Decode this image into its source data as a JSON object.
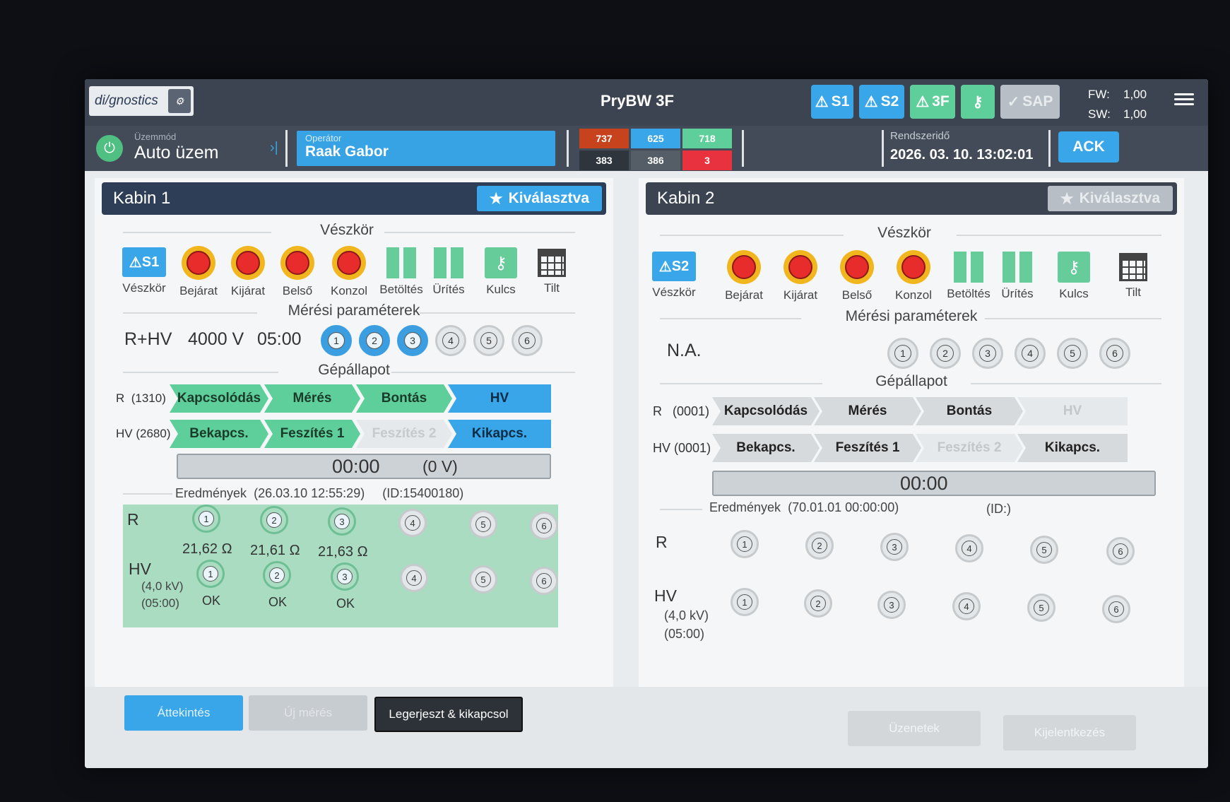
{
  "topbar": {
    "logo_text": "di/gnostics",
    "title": "PryBW 3F",
    "alarms": [
      {
        "label": "S1",
        "color": "#38a6e8"
      },
      {
        "label": "S2",
        "color": "#38a6e8"
      },
      {
        "label": "3F",
        "color": "#5ecf9a"
      }
    ],
    "sap_label": "SAP",
    "fw_label": "FW:",
    "fw_value": "1,00",
    "sw_label": "SW:",
    "sw_value": "1,00"
  },
  "status": {
    "mode_caption": "Üzemmód",
    "mode_value": "Auto üzem",
    "operator_caption": "Operátor",
    "operator_value": "Raak Gabor",
    "counters": [
      {
        "value": "737",
        "color": "#c6431e"
      },
      {
        "value": "625",
        "color": "#38a6e8"
      },
      {
        "value": "718",
        "color": "#5ecf9a"
      },
      {
        "value": "383",
        "color": "#2f353c"
      },
      {
        "value": "386",
        "color": "#555d66"
      },
      {
        "value": "3",
        "color": "#e8333f"
      }
    ],
    "system_time_caption": "Rendszeridő",
    "system_time_value": "2026. 03. 10. 13:02:01",
    "ack_label": "ACK"
  },
  "cabin1": {
    "title": "Kabin 1",
    "selected_label": "Kiválasztva",
    "estop_title": "Vészkör",
    "vb_label": "S1",
    "icons": [
      "Vészkör",
      "Bejárat",
      "Kijárat",
      "Belső",
      "Konzol",
      "Betöltés",
      "Ürítés",
      "Kulcs",
      "Tilt"
    ],
    "params_title": "Mérési paraméterek",
    "params": {
      "mode": "R+HV",
      "voltage": "4000 V",
      "time": "05:00"
    },
    "channels": [
      "1",
      "2",
      "3",
      "4",
      "5",
      "6"
    ],
    "state_title": "Gépállapot",
    "r_label": "R",
    "r_code": "(1310)",
    "hv_label": "HV",
    "hv_code": "(2680)",
    "r_steps": [
      "Kapcsolódás",
      "Mérés",
      "Bontás",
      "HV"
    ],
    "hv_steps": [
      "Bekapcs.",
      "Feszítés 1",
      "Feszítés 2",
      "Kikapcs."
    ],
    "progress_time": "00:00",
    "progress_voltage": "(0 V)",
    "results_title": "Eredmények",
    "results_date": "(26.03.10 12:55:29)",
    "results_id": "(ID:15400180)",
    "res_r_label": "R",
    "res_r_values": [
      "21,62 Ω",
      "21,61 Ω",
      "21,63 Ω"
    ],
    "res_hv_label": "HV",
    "res_hv_kv": "(4,0 kV)",
    "res_hv_time": "(05:00)",
    "res_hv_values": [
      "OK",
      "OK",
      "OK"
    ]
  },
  "cabin2": {
    "title": "Kabin 2",
    "selected_label": "Kiválasztva",
    "estop_title": "Vészkör",
    "vb_label": "S2",
    "icons": [
      "Vészkör",
      "Bejárat",
      "Kijárat",
      "Belső",
      "Konzol",
      "Betöltés",
      "Ürítés",
      "Kulcs",
      "Tilt"
    ],
    "params_title": "Mérési paraméterek",
    "params_na": "N.A.",
    "channels": [
      "1",
      "2",
      "3",
      "4",
      "5",
      "6"
    ],
    "state_title": "Gépállapot",
    "r_label": "R",
    "r_code": "(0001)",
    "hv_label": "HV",
    "hv_code": "(0001)",
    "r_steps": [
      "Kapcsolódás",
      "Mérés",
      "Bontás",
      "HV"
    ],
    "hv_steps": [
      "Bekapcs.",
      "Feszítés 1",
      "Feszítés 2",
      "Kikapcs."
    ],
    "progress_time": "00:00",
    "results_title": "Eredmények",
    "results_date": "(70.01.01 00:00:00)",
    "results_id": "(ID:)",
    "res_r_label": "R",
    "res_hv_label": "HV",
    "res_hv_kv": "(4,0 kV)",
    "res_hv_time": "(05:00)"
  },
  "bottom": {
    "overview": "Áttekintés",
    "new_measure": "Új mérés",
    "discharge": "Legerjeszt & kikapcsol",
    "messages": "Üzenetek",
    "logout": "Kijelentkezés"
  }
}
